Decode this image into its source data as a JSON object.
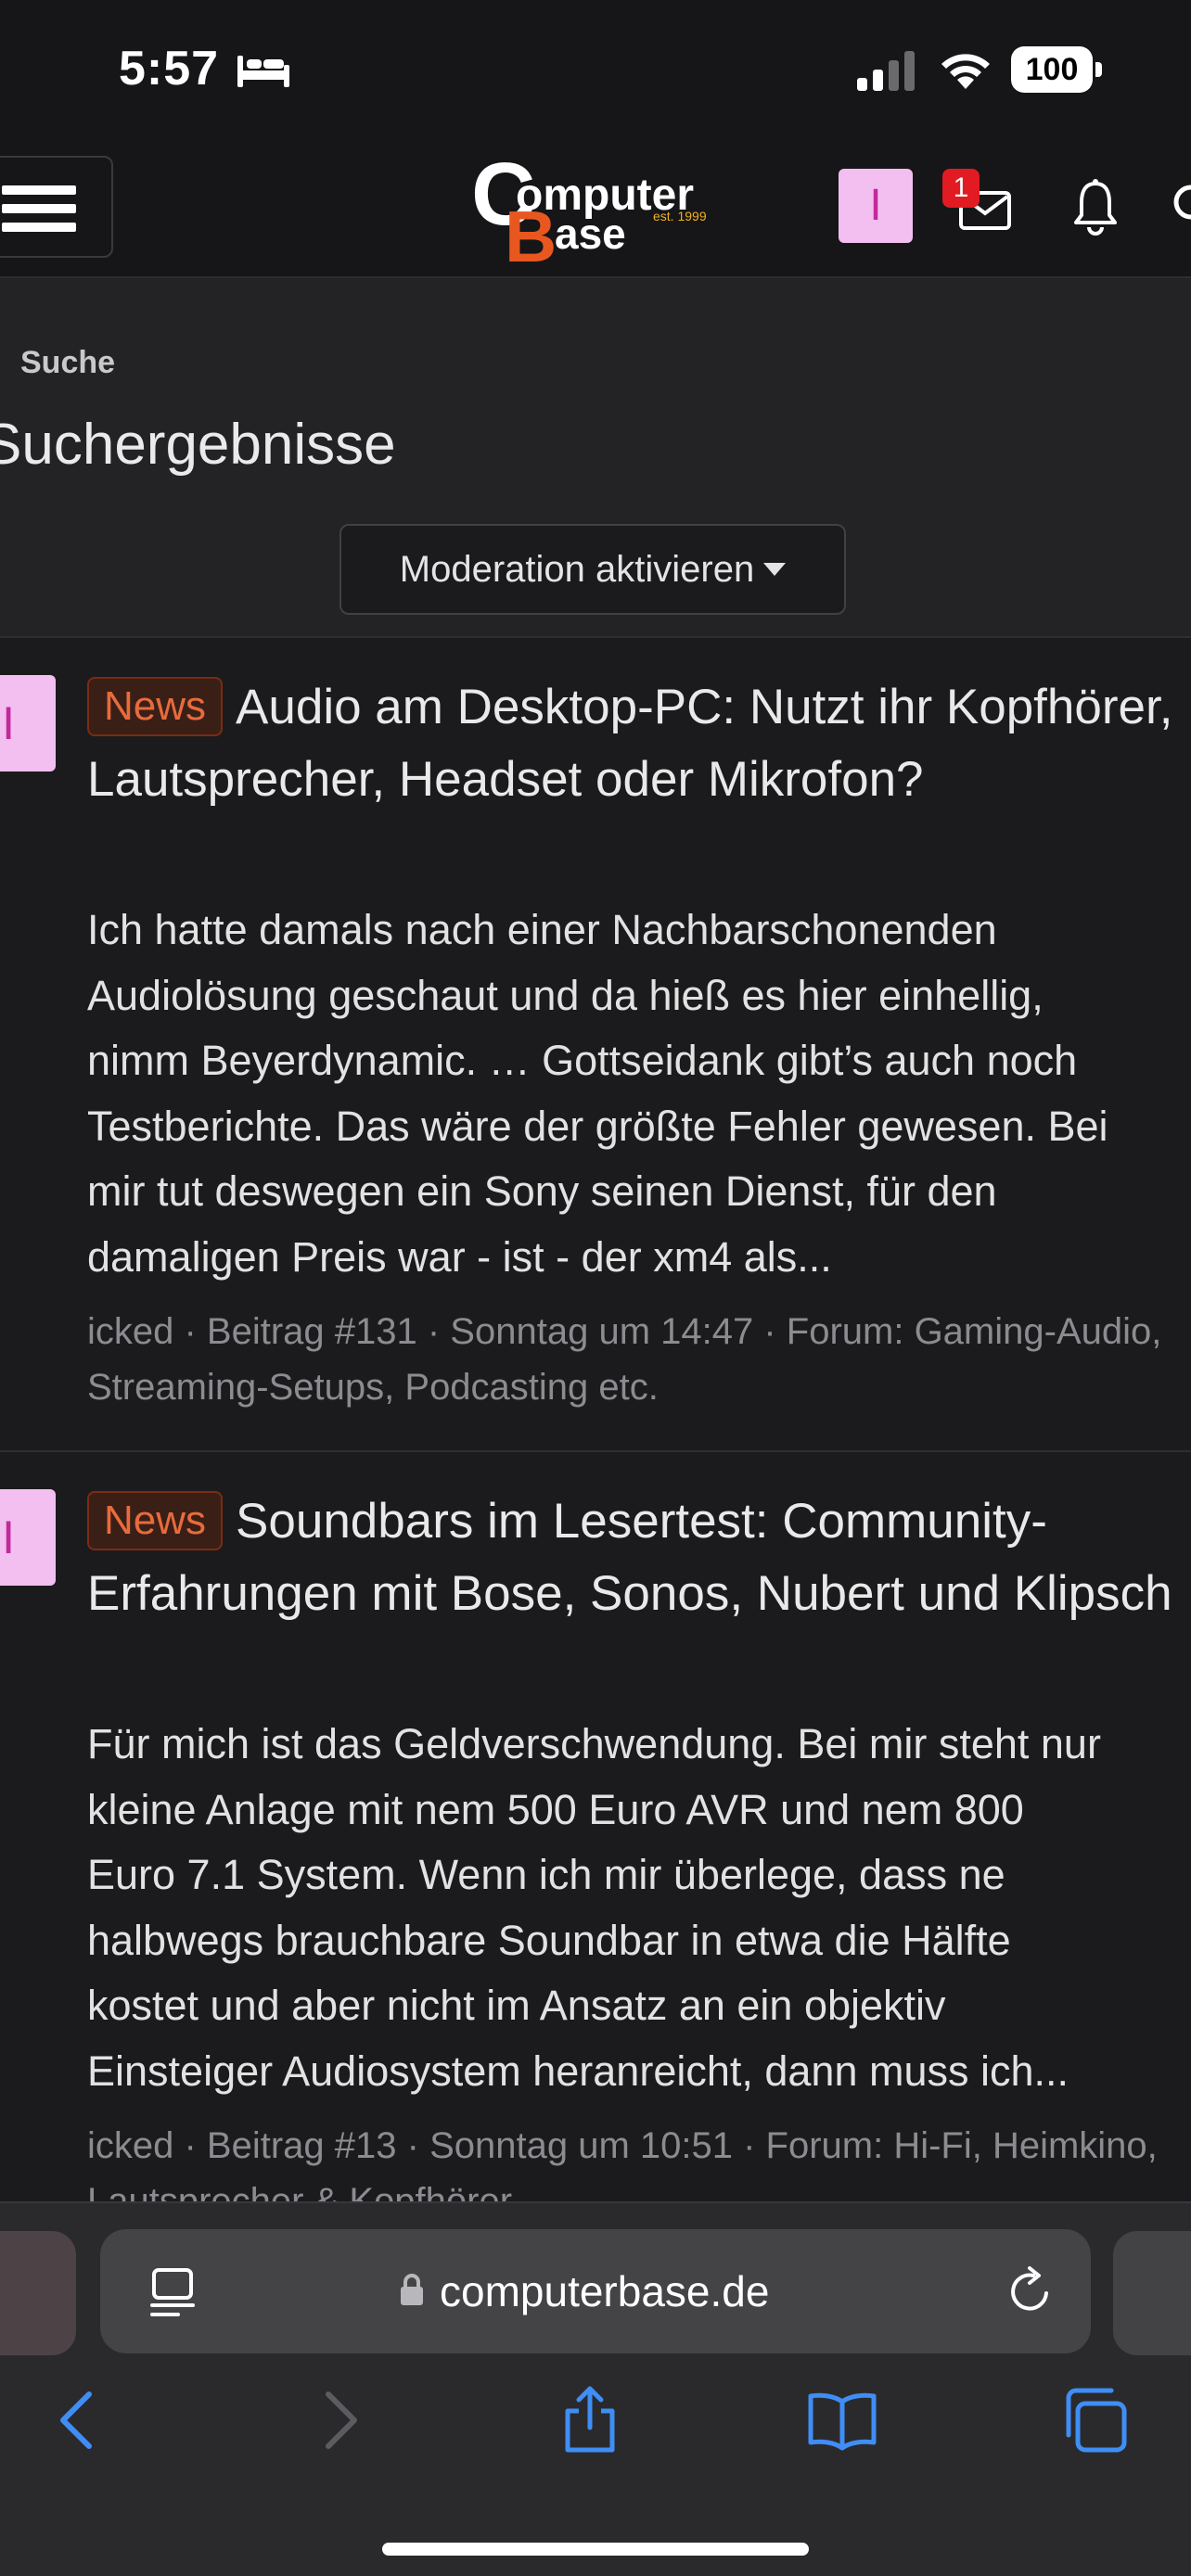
{
  "status_bar": {
    "time": "5:57",
    "battery": "100",
    "icons": [
      "bed-icon",
      "signal-icon",
      "wifi-icon",
      "battery-icon"
    ]
  },
  "header": {
    "logo_text": "ComputerBase est. 1999",
    "avatar_letter": "I",
    "mail_badge": "1",
    "icons": [
      "menu-icon",
      "mail-icon",
      "bell-icon",
      "search-icon"
    ]
  },
  "page": {
    "breadcrumb": "Suche",
    "title": "Suchergebnisse",
    "moderation_button": "Moderation aktivieren"
  },
  "results": [
    {
      "avatar_letter": "I",
      "tag": "News",
      "title": "Audio am Desktop-PC: Nutzt ihr Kopfhörer, Lautsprecher, Headset oder Mikrofon?",
      "snippet": [
        "Ich hatte damals nach einer Nachbarschonenden",
        "Audiolösung geschaut und da hieß es hier einhellig,",
        "nimm Beyerdynamic. … Gottseidank gibt’s auch noch",
        "Testberichte. Das wäre der größte Fehler gewesen. Bei",
        "mir tut deswegen ein Sony seinen Dienst, für den",
        "damaligen Preis war - ist - der xm4 als..."
      ],
      "meta": "icked · Beitrag #131 · Sonntag um 14:47 · Forum: Gaming-Audio, Streaming-Setups, Podcasting etc."
    },
    {
      "avatar_letter": "I",
      "tag": "News",
      "title": "Soundbars im Lesertest: Community-Erfahrungen mit Bose, Sonos, Nubert und Klipsch",
      "snippet": [
        "Für mich ist das Geldverschwendung. Bei mir steht nur",
        "kleine Anlage mit nem 500 Euro AVR und nem 800",
        "Euro 7.1 System. Wenn ich mir überlege, dass ne",
        "halbwegs brauchbare Soundbar in etwa die Hälfte",
        "kostet und aber nicht im Ansatz an ein objektiv",
        "Einsteiger Audiosystem heranreicht, dann muss ich..."
      ],
      "meta": "icked · Beitrag #13 · Sonntag um 10:51 · Forum: Hi-Fi, Heimkino, Lautsprecher & Kopfhörer"
    }
  ],
  "browser": {
    "url": "computerbase.de",
    "icons": [
      "reader-icon",
      "lock-icon",
      "reload-icon",
      "back-icon",
      "forward-icon",
      "share-icon",
      "bookmarks-icon",
      "tabs-icon"
    ]
  },
  "colors": {
    "background": "#1b1b1d",
    "header": "#161618",
    "news_tag": "#e86b3c",
    "avatar": "#f2bff0",
    "badge": "#e21b22",
    "accent_blue": "#3f8ef5"
  }
}
